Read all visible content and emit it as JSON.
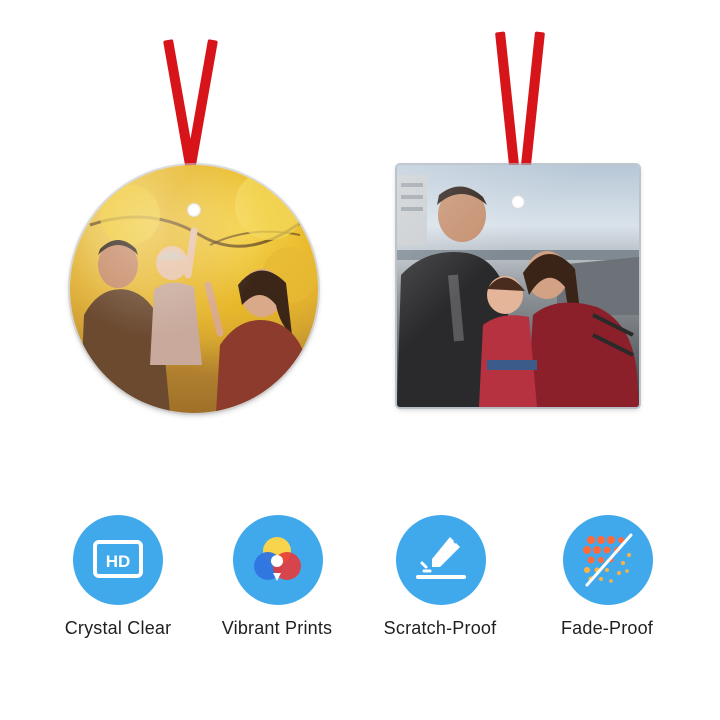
{
  "ornaments": [
    {
      "shape": "round",
      "photo": "family-autumn-photo"
    },
    {
      "shape": "square",
      "photo": "family-waterfront-photo"
    }
  ],
  "features": [
    {
      "label": "Crystal Clear",
      "icon": "hd-icon",
      "icon_text": "HD"
    },
    {
      "label": "Vibrant Prints",
      "icon": "color-circles-icon"
    },
    {
      "label": "Scratch-Proof",
      "icon": "blade-icon"
    },
    {
      "label": "Fade-Proof",
      "icon": "fade-dots-icon"
    }
  ],
  "colors": {
    "icon_background": "#3fa9ec",
    "ribbon": "#d8141b",
    "label_text": "#1f1f1f"
  }
}
